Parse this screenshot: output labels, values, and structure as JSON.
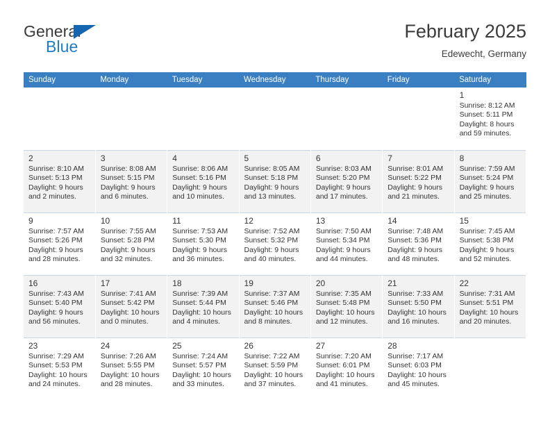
{
  "brand": {
    "name_part1": "General",
    "name_part2": "Blue",
    "triangle_color": "#1565b0",
    "blue_color": "#1d7dc4"
  },
  "header": {
    "title": "February 2025",
    "subtitle": "Edewecht, Germany",
    "header_bg": "#3a7fc1"
  },
  "weekdays": [
    "Sunday",
    "Monday",
    "Tuesday",
    "Wednesday",
    "Thursday",
    "Friday",
    "Saturday"
  ],
  "weeks": [
    [
      {
        "day": "",
        "sunrise": "",
        "sunset": "",
        "daylight1": "",
        "daylight2": "",
        "empty": true
      },
      {
        "day": "",
        "sunrise": "",
        "sunset": "",
        "daylight1": "",
        "daylight2": "",
        "empty": true
      },
      {
        "day": "",
        "sunrise": "",
        "sunset": "",
        "daylight1": "",
        "daylight2": "",
        "empty": true
      },
      {
        "day": "",
        "sunrise": "",
        "sunset": "",
        "daylight1": "",
        "daylight2": "",
        "empty": true
      },
      {
        "day": "",
        "sunrise": "",
        "sunset": "",
        "daylight1": "",
        "daylight2": "",
        "empty": true
      },
      {
        "day": "",
        "sunrise": "",
        "sunset": "",
        "daylight1": "",
        "daylight2": "",
        "empty": true
      },
      {
        "day": "1",
        "sunrise": "Sunrise: 8:12 AM",
        "sunset": "Sunset: 5:11 PM",
        "daylight1": "Daylight: 8 hours",
        "daylight2": "and 59 minutes.",
        "empty": false
      }
    ],
    [
      {
        "day": "2",
        "sunrise": "Sunrise: 8:10 AM",
        "sunset": "Sunset: 5:13 PM",
        "daylight1": "Daylight: 9 hours",
        "daylight2": "and 2 minutes.",
        "empty": false
      },
      {
        "day": "3",
        "sunrise": "Sunrise: 8:08 AM",
        "sunset": "Sunset: 5:15 PM",
        "daylight1": "Daylight: 9 hours",
        "daylight2": "and 6 minutes.",
        "empty": false
      },
      {
        "day": "4",
        "sunrise": "Sunrise: 8:06 AM",
        "sunset": "Sunset: 5:16 PM",
        "daylight1": "Daylight: 9 hours",
        "daylight2": "and 10 minutes.",
        "empty": false
      },
      {
        "day": "5",
        "sunrise": "Sunrise: 8:05 AM",
        "sunset": "Sunset: 5:18 PM",
        "daylight1": "Daylight: 9 hours",
        "daylight2": "and 13 minutes.",
        "empty": false
      },
      {
        "day": "6",
        "sunrise": "Sunrise: 8:03 AM",
        "sunset": "Sunset: 5:20 PM",
        "daylight1": "Daylight: 9 hours",
        "daylight2": "and 17 minutes.",
        "empty": false
      },
      {
        "day": "7",
        "sunrise": "Sunrise: 8:01 AM",
        "sunset": "Sunset: 5:22 PM",
        "daylight1": "Daylight: 9 hours",
        "daylight2": "and 21 minutes.",
        "empty": false
      },
      {
        "day": "8",
        "sunrise": "Sunrise: 7:59 AM",
        "sunset": "Sunset: 5:24 PM",
        "daylight1": "Daylight: 9 hours",
        "daylight2": "and 25 minutes.",
        "empty": false
      }
    ],
    [
      {
        "day": "9",
        "sunrise": "Sunrise: 7:57 AM",
        "sunset": "Sunset: 5:26 PM",
        "daylight1": "Daylight: 9 hours",
        "daylight2": "and 28 minutes.",
        "empty": false
      },
      {
        "day": "10",
        "sunrise": "Sunrise: 7:55 AM",
        "sunset": "Sunset: 5:28 PM",
        "daylight1": "Daylight: 9 hours",
        "daylight2": "and 32 minutes.",
        "empty": false
      },
      {
        "day": "11",
        "sunrise": "Sunrise: 7:53 AM",
        "sunset": "Sunset: 5:30 PM",
        "daylight1": "Daylight: 9 hours",
        "daylight2": "and 36 minutes.",
        "empty": false
      },
      {
        "day": "12",
        "sunrise": "Sunrise: 7:52 AM",
        "sunset": "Sunset: 5:32 PM",
        "daylight1": "Daylight: 9 hours",
        "daylight2": "and 40 minutes.",
        "empty": false
      },
      {
        "day": "13",
        "sunrise": "Sunrise: 7:50 AM",
        "sunset": "Sunset: 5:34 PM",
        "daylight1": "Daylight: 9 hours",
        "daylight2": "and 44 minutes.",
        "empty": false
      },
      {
        "day": "14",
        "sunrise": "Sunrise: 7:48 AM",
        "sunset": "Sunset: 5:36 PM",
        "daylight1": "Daylight: 9 hours",
        "daylight2": "and 48 minutes.",
        "empty": false
      },
      {
        "day": "15",
        "sunrise": "Sunrise: 7:45 AM",
        "sunset": "Sunset: 5:38 PM",
        "daylight1": "Daylight: 9 hours",
        "daylight2": "and 52 minutes.",
        "empty": false
      }
    ],
    [
      {
        "day": "16",
        "sunrise": "Sunrise: 7:43 AM",
        "sunset": "Sunset: 5:40 PM",
        "daylight1": "Daylight: 9 hours",
        "daylight2": "and 56 minutes.",
        "empty": false
      },
      {
        "day": "17",
        "sunrise": "Sunrise: 7:41 AM",
        "sunset": "Sunset: 5:42 PM",
        "daylight1": "Daylight: 10 hours",
        "daylight2": "and 0 minutes.",
        "empty": false
      },
      {
        "day": "18",
        "sunrise": "Sunrise: 7:39 AM",
        "sunset": "Sunset: 5:44 PM",
        "daylight1": "Daylight: 10 hours",
        "daylight2": "and 4 minutes.",
        "empty": false
      },
      {
        "day": "19",
        "sunrise": "Sunrise: 7:37 AM",
        "sunset": "Sunset: 5:46 PM",
        "daylight1": "Daylight: 10 hours",
        "daylight2": "and 8 minutes.",
        "empty": false
      },
      {
        "day": "20",
        "sunrise": "Sunrise: 7:35 AM",
        "sunset": "Sunset: 5:48 PM",
        "daylight1": "Daylight: 10 hours",
        "daylight2": "and 12 minutes.",
        "empty": false
      },
      {
        "day": "21",
        "sunrise": "Sunrise: 7:33 AM",
        "sunset": "Sunset: 5:50 PM",
        "daylight1": "Daylight: 10 hours",
        "daylight2": "and 16 minutes.",
        "empty": false
      },
      {
        "day": "22",
        "sunrise": "Sunrise: 7:31 AM",
        "sunset": "Sunset: 5:51 PM",
        "daylight1": "Daylight: 10 hours",
        "daylight2": "and 20 minutes.",
        "empty": false
      }
    ],
    [
      {
        "day": "23",
        "sunrise": "Sunrise: 7:29 AM",
        "sunset": "Sunset: 5:53 PM",
        "daylight1": "Daylight: 10 hours",
        "daylight2": "and 24 minutes.",
        "empty": false
      },
      {
        "day": "24",
        "sunrise": "Sunrise: 7:26 AM",
        "sunset": "Sunset: 5:55 PM",
        "daylight1": "Daylight: 10 hours",
        "daylight2": "and 28 minutes.",
        "empty": false
      },
      {
        "day": "25",
        "sunrise": "Sunrise: 7:24 AM",
        "sunset": "Sunset: 5:57 PM",
        "daylight1": "Daylight: 10 hours",
        "daylight2": "and 33 minutes.",
        "empty": false
      },
      {
        "day": "26",
        "sunrise": "Sunrise: 7:22 AM",
        "sunset": "Sunset: 5:59 PM",
        "daylight1": "Daylight: 10 hours",
        "daylight2": "and 37 minutes.",
        "empty": false
      },
      {
        "day": "27",
        "sunrise": "Sunrise: 7:20 AM",
        "sunset": "Sunset: 6:01 PM",
        "daylight1": "Daylight: 10 hours",
        "daylight2": "and 41 minutes.",
        "empty": false
      },
      {
        "day": "28",
        "sunrise": "Sunrise: 7:17 AM",
        "sunset": "Sunset: 6:03 PM",
        "daylight1": "Daylight: 10 hours",
        "daylight2": "and 45 minutes.",
        "empty": false
      },
      {
        "day": "",
        "sunrise": "",
        "sunset": "",
        "daylight1": "",
        "daylight2": "",
        "empty": true
      }
    ]
  ]
}
